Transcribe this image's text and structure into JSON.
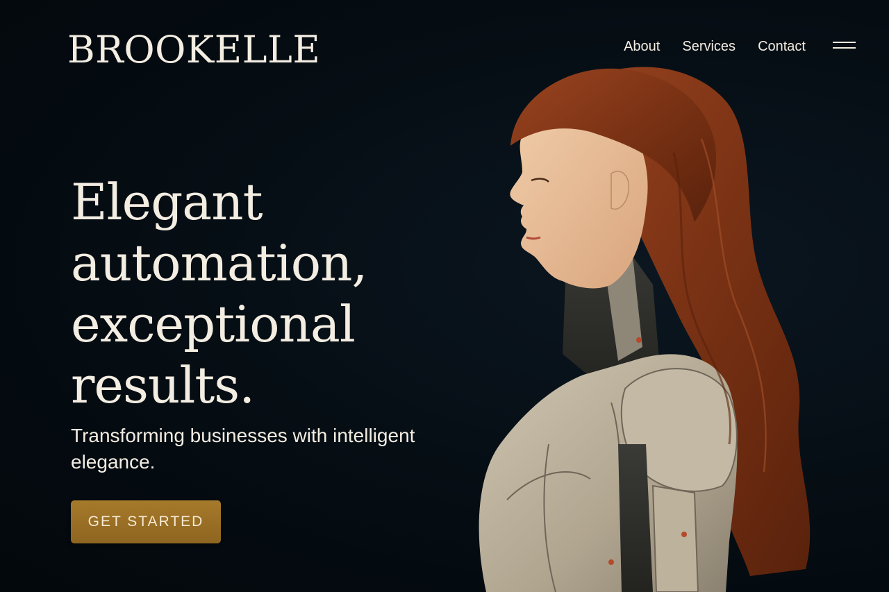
{
  "brand": {
    "logo_text": "BROOKELLE"
  },
  "nav": {
    "items": [
      {
        "label": "About"
      },
      {
        "label": "Services"
      },
      {
        "label": "Contact"
      }
    ],
    "menu_icon": "hamburger-menu-icon"
  },
  "hero": {
    "headline_lines": [
      "Elegant",
      "automation,",
      "exceptional",
      "results."
    ],
    "subtext": "Transforming businesses  with intelligent elegance.",
    "cta_label": "GET STARTED",
    "image": "android-woman-profile-illustration"
  },
  "colors": {
    "background": "#050c12",
    "text": "#f3ede2",
    "accent": "#9a7026",
    "hair": "#8a3a1a",
    "armor": "#b8ad98"
  }
}
